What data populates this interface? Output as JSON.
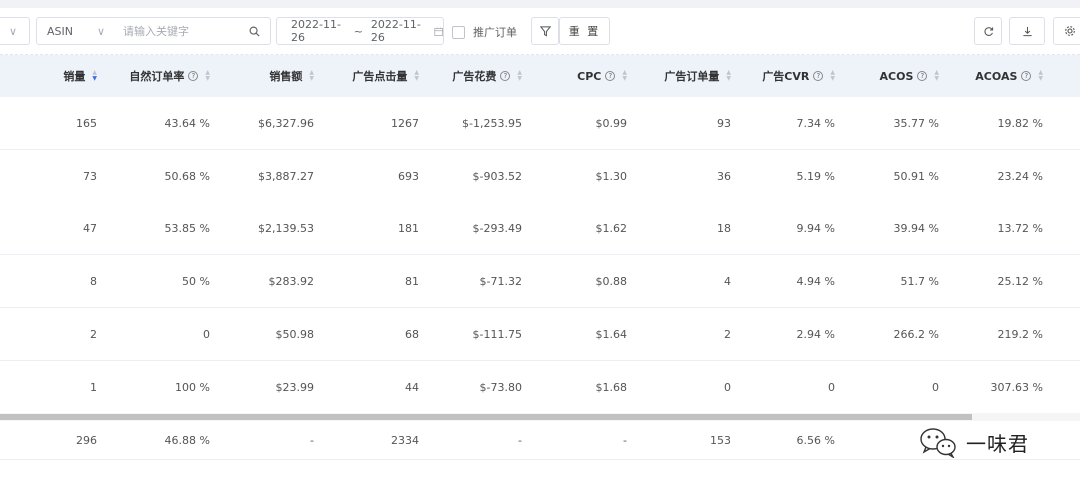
{
  "toolbar": {
    "asin_select": "ASIN",
    "keyword_placeholder": "请输入关键字",
    "date_start": "2022-11-26",
    "date_sep": "~",
    "date_end": "2022-11-26",
    "ad_order_checkbox_label": "推广订单",
    "reset_label": "重 置"
  },
  "table": {
    "columns": [
      {
        "label": "销量",
        "help": false,
        "sort": "desc"
      },
      {
        "label": "自然订单率",
        "help": true,
        "sort": "none"
      },
      {
        "label": "销售额",
        "help": false,
        "sort": "none"
      },
      {
        "label": "广告点击量",
        "help": false,
        "sort": "none"
      },
      {
        "label": "广告花费",
        "help": true,
        "sort": "none"
      },
      {
        "label": "CPC",
        "help": true,
        "sort": "none"
      },
      {
        "label": "广告订单量",
        "help": false,
        "sort": "none"
      },
      {
        "label": "广告CVR",
        "help": true,
        "sort": "none"
      },
      {
        "label": "ACOS",
        "help": true,
        "sort": "none"
      },
      {
        "label": "ACOAS",
        "help": true,
        "sort": "none"
      }
    ],
    "rows": [
      [
        "165",
        "43.64 %",
        "$6,327.96",
        "1267",
        "$-1,253.95",
        "$0.99",
        "93",
        "7.34 %",
        "35.77 %",
        "19.82 %"
      ],
      [
        "73",
        "50.68 %",
        "$3,887.27",
        "693",
        "$-903.52",
        "$1.30",
        "36",
        "5.19 %",
        "50.91 %",
        "23.24 %"
      ],
      [
        "47",
        "53.85 %",
        "$2,139.53",
        "181",
        "$-293.49",
        "$1.62",
        "18",
        "9.94 %",
        "39.94 %",
        "13.72 %"
      ],
      [
        "8",
        "50 %",
        "$283.92",
        "81",
        "$-71.32",
        "$0.88",
        "4",
        "4.94 %",
        "51.7 %",
        "25.12 %"
      ],
      [
        "2",
        "0",
        "$50.98",
        "68",
        "$-111.75",
        "$1.64",
        "2",
        "2.94 %",
        "266.2 %",
        "219.2 %"
      ],
      [
        "1",
        "100 %",
        "$23.99",
        "44",
        "$-73.80",
        "$1.68",
        "0",
        "0",
        "0",
        "307.63 %"
      ]
    ],
    "totals": [
      "296",
      "46.88 %",
      "-",
      "2334",
      "-",
      "-",
      "153",
      "6.56 %",
      "",
      ""
    ]
  },
  "watermark": {
    "text": "一味君",
    "icon": "wechat-icon"
  },
  "colors": {
    "header_bg": "#eef3fa",
    "sort_active": "#3a6ee8"
  }
}
